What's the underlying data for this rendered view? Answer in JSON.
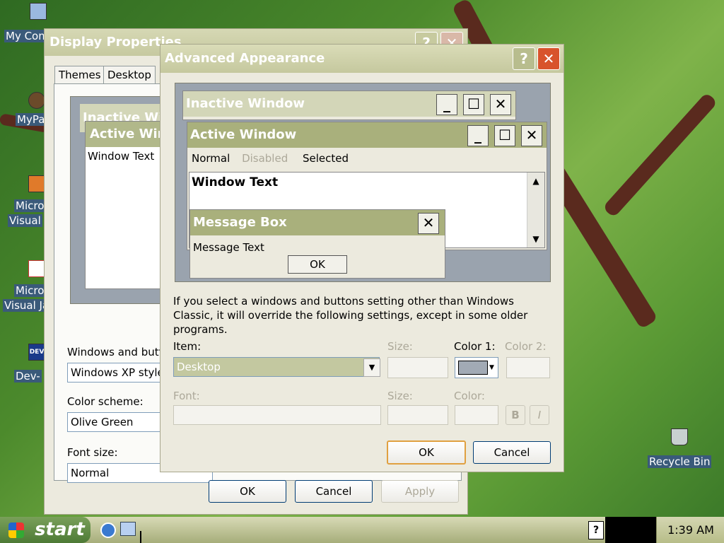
{
  "desktop": {
    "icons": [
      {
        "label": "My Com",
        "icon": "my-computer-icon"
      },
      {
        "label": "MyPa",
        "icon": "mypal-icon"
      },
      {
        "label1": "Micro",
        "label2": "Visual",
        "icon": "visual-studio-icon"
      },
      {
        "label1": "Micro",
        "label2": "Visual Ja",
        "icon": "visual-java-icon"
      },
      {
        "label": "Dev-",
        "icon": "dev-cpp-icon",
        "badge": "DEV"
      },
      {
        "label": "Recycle Bin",
        "icon": "recycle-bin-icon"
      }
    ]
  },
  "display_properties": {
    "title": "Display Properties",
    "tabs": [
      "Themes",
      "Desktop"
    ],
    "preview": {
      "inactive_title": "Inactive Wi",
      "active_title": "Active Win",
      "window_text": "Window Text"
    },
    "windows_buttons_label": "Windows and butto",
    "windows_buttons_value": "Windows XP style",
    "color_scheme_label": "Color scheme:",
    "color_scheme_value": "Olive Green",
    "font_size_label": "Font size:",
    "font_size_value": "Normal",
    "ok": "OK",
    "cancel": "Cancel",
    "apply": "Apply"
  },
  "advanced": {
    "title": "Advanced Appearance",
    "help": "?",
    "close": "✕",
    "preview": {
      "inactive_title": "Inactive Window",
      "active_title": "Active Window",
      "menu": [
        "Normal",
        "Disabled",
        "Selected"
      ],
      "window_text": "Window Text",
      "msgbox_title": "Message Box",
      "msgbox_text": "Message Text",
      "msgbox_ok": "OK"
    },
    "info": "If you select a windows and buttons setting other than Windows Classic, it will override the following settings, except in some older programs.",
    "item_label": "Item:",
    "item_value": "Desktop",
    "size_label": "Size:",
    "color1_label": "Color 1:",
    "color2_label": "Color 2:",
    "color1_value": "#a2aab5",
    "font_label": "Font:",
    "size2_label": "Size:",
    "color_label": "Color:",
    "bold": "B",
    "italic": "I",
    "ok": "OK",
    "cancel": "Cancel"
  },
  "taskbar": {
    "start": "start",
    "clock": "1:39 AM"
  },
  "colors": {
    "accent": "#b2b98a",
    "title_active": "#a9b07c",
    "title_inactive": "#d3d6b8"
  }
}
